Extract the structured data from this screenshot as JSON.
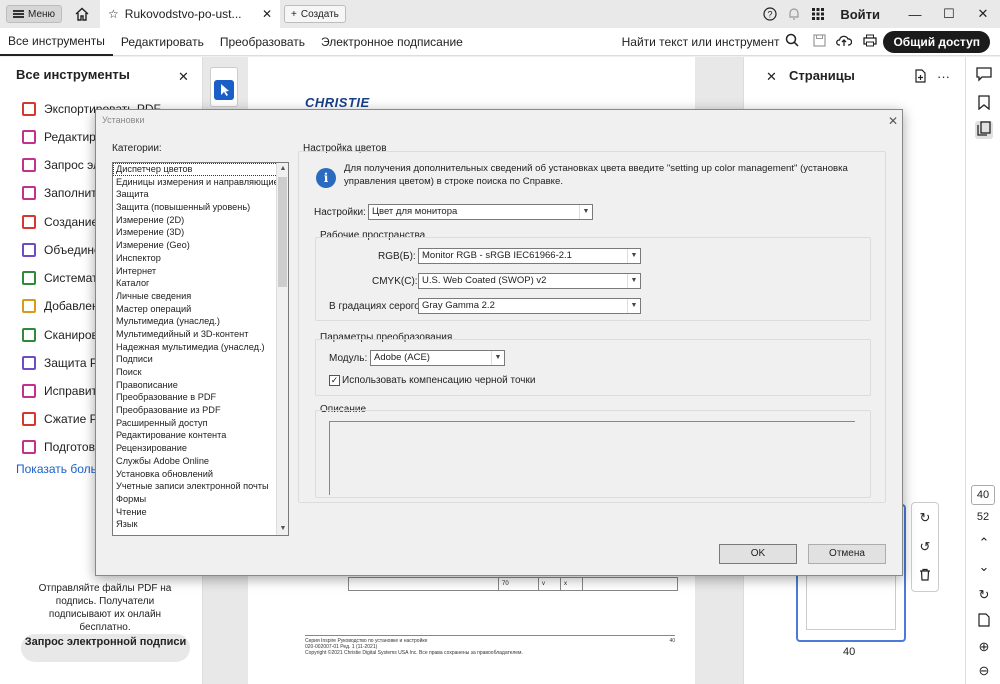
{
  "titlebar": {
    "menu_label": "Меню",
    "tab_title": "Rukovodstvo-po-ust...",
    "new_tab_label": "Создать",
    "signin_label": "Войти"
  },
  "toolbar": {
    "tabs": [
      "Все инструменты",
      "Редактировать",
      "Преобразовать",
      "Электронное подписание"
    ],
    "find_label": "Найти текст или инструмент",
    "share_label": "Общий доступ"
  },
  "left_panel": {
    "title": "Все инструменты",
    "items": [
      {
        "label": "Экспортировать PDF",
        "color": "#d8372f"
      },
      {
        "label": "Редактиров",
        "color": "#c1328a"
      },
      {
        "label": "Запрос эле",
        "color": "#c1328a"
      },
      {
        "label": "Заполнить",
        "color": "#c1328a"
      },
      {
        "label": "Создание с",
        "color": "#d8372f"
      },
      {
        "label": "Объединен",
        "color": "#6f4bc8"
      },
      {
        "label": "Системати",
        "color": "#2f8a3a"
      },
      {
        "label": "Добавлени",
        "color": "#d99a1a"
      },
      {
        "label": "Сканирова",
        "color": "#2f8a3a"
      },
      {
        "label": "Защита PD",
        "color": "#6f4bc8"
      },
      {
        "label": "Исправить",
        "color": "#c1328a"
      },
      {
        "label": "Сжатие PD",
        "color": "#d8372f"
      },
      {
        "label": "Подготовит",
        "color": "#c1328a"
      }
    ],
    "show_more": "Показать больше",
    "promo_text": "Отправляйте файлы PDF на подпись. Получатели подписывают их онлайн бесплатно.",
    "request_button": "Запрос электронной подписи"
  },
  "document": {
    "brand": "CHRISTIE",
    "table_cells": [
      "70",
      "v",
      "x"
    ],
    "footer_line1": "Серия Inspire Руководство по установке и настройке",
    "footer_line2": "020-002007-01 Ред. 1 (11-2021)",
    "footer_line3": "Copyright ©2021 Christie Digital Systems USA Inc. Все права сохранены за правообладателем.",
    "footer_page": "40"
  },
  "pages_panel": {
    "title": "Страницы",
    "thumb_page_label": "40"
  },
  "rail": {
    "current_page": "40",
    "total_pages": "52"
  },
  "dialog": {
    "title": "Установки",
    "categories_label": "Категории:",
    "categories": [
      "Диспетчер цветов",
      "Единицы измерения и направляющие",
      "Защита",
      "Защита (повышенный уровень)",
      "Измерение (2D)",
      "Измерение (3D)",
      "Измерение (Geo)",
      "Инспектор",
      "Интернет",
      "Каталог",
      "Личные сведения",
      "Мастер операций",
      "Мультимедиа (унаслед.)",
      "Мультимедийный и 3D-контент",
      "Надежная мультимедиа (унаслед.)",
      "Подписи",
      "Поиск",
      "Правописание",
      "Преобразование в PDF",
      "Преобразование из PDF",
      "Расширенный доступ",
      "Редактирование контента",
      "Рецензирование",
      "Службы Adobe Online",
      "Установка обновлений",
      "Учетные записи электронной почты",
      "Формы",
      "Чтение",
      "Язык"
    ],
    "section_title": "Настройка цветов",
    "info_text": "Для получения дополнительных сведений об установках цвета введите \"setting up color management\" (установка управления цветом) в строке поиска по Справке.",
    "settings_label": "Настройки:",
    "settings_value": "Цвет для монитора",
    "workspaces_title": "Рабочие пространства",
    "rgb_label": "RGB(Б):",
    "rgb_value": "Monitor RGB - sRGB IEC61966-2.1",
    "cmyk_label": "CMYK(С):",
    "cmyk_value": "U.S. Web Coated (SWOP) v2",
    "gray_label": "В градациях серого:",
    "gray_value": "Gray Gamma 2.2",
    "conversion_title": "Параметры преобразования",
    "module_label": "Модуль:",
    "module_value": "Adobe (ACE)",
    "blackpoint_label": "Использовать компенсацию черной точки",
    "blackpoint_checked": true,
    "description_title": "Описание",
    "ok_label": "OK",
    "cancel_label": "Отмена"
  }
}
